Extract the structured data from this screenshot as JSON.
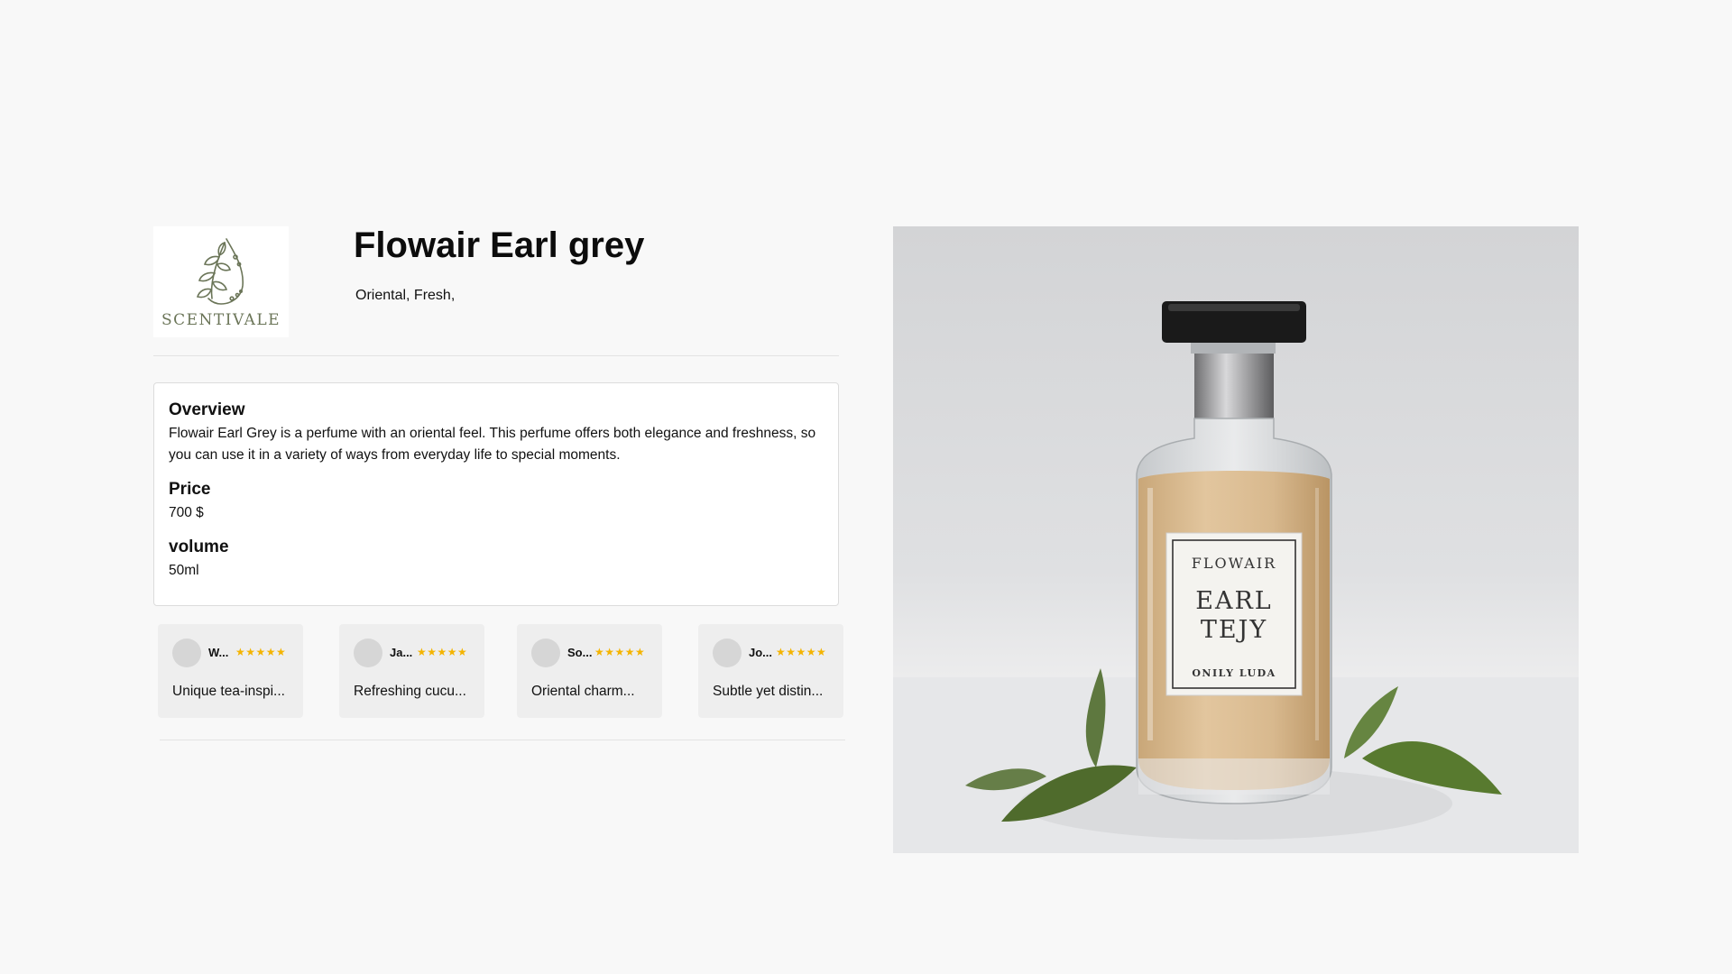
{
  "brand": {
    "logo_text": "SCENTIVALE"
  },
  "product": {
    "title": "Flowair Earl grey",
    "tags": "Oriental, Fresh,"
  },
  "details": {
    "overview_heading": "Overview",
    "overview_text": "Flowair Earl Grey is a perfume with an oriental feel. This perfume offers both elegance and freshness, so you can use it in a variety of ways from everyday life to special moments.",
    "price_heading": "Price",
    "price_value": "700 $",
    "volume_heading": "volume",
    "volume_value": "50ml"
  },
  "reviews": [
    {
      "name": "W...",
      "stars": "★★★★★",
      "text": "Unique tea-inspi..."
    },
    {
      "name": "Ja...",
      "stars": "★★★★★",
      "text": "Refreshing cucu..."
    },
    {
      "name": "So...",
      "stars": "★★★★★",
      "text": "Oriental charm..."
    },
    {
      "name": "Jo...",
      "stars": "★★★★★",
      "text": "Subtle yet distin..."
    }
  ],
  "image_label": {
    "line1": "FLOWAIR",
    "line2": "EARL",
    "line3": "TEJY",
    "line4": "ONILY LUDA"
  },
  "colors": {
    "star": "#f4b400",
    "logo": "#6b7558",
    "cap": "#1a1a1a",
    "liquid": "#d9b88c"
  }
}
